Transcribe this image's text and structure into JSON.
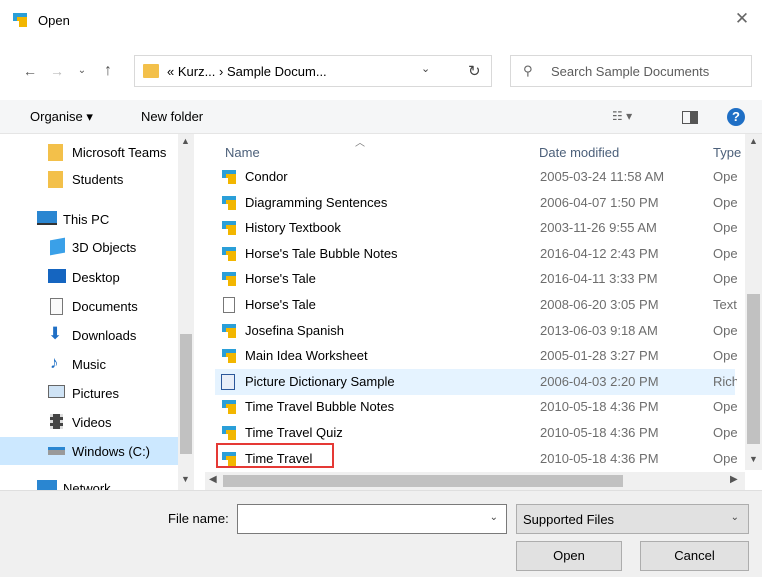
{
  "window": {
    "title": "Open"
  },
  "address": {
    "path": "« Kurz... › Sample Docum..."
  },
  "search": {
    "placeholder": "Search Sample Documents"
  },
  "toolbar": {
    "organise_label": "Organise ▾",
    "new_folder_label": "New folder",
    "help_label": "?"
  },
  "sidebar": {
    "items": [
      {
        "label": "Microsoft Teams",
        "icon": "folder-icon"
      },
      {
        "label": "Students",
        "icon": "folder-icon"
      },
      {
        "label": "This PC",
        "icon": "computer-icon"
      },
      {
        "label": "3D Objects",
        "icon": "3d-objects-icon"
      },
      {
        "label": "Desktop",
        "icon": "desktop-icon"
      },
      {
        "label": "Documents",
        "icon": "documents-icon"
      },
      {
        "label": "Downloads",
        "icon": "downloads-icon"
      },
      {
        "label": "Music",
        "icon": "music-icon"
      },
      {
        "label": "Pictures",
        "icon": "pictures-icon"
      },
      {
        "label": "Videos",
        "icon": "videos-icon"
      },
      {
        "label": "Windows (C:)",
        "icon": "drive-icon"
      },
      {
        "label": "Network",
        "icon": "network-icon"
      }
    ]
  },
  "columns": {
    "name": "Name",
    "date": "Date modified",
    "type": "Type"
  },
  "files": [
    {
      "name": "Condor",
      "date": "2005-03-24 11:58 AM",
      "type": "Oper"
    },
    {
      "name": "Diagramming Sentences",
      "date": "2006-04-07 1:50 PM",
      "type": "Oper"
    },
    {
      "name": "History Textbook",
      "date": "2003-11-26 9:55 AM",
      "type": "Oper"
    },
    {
      "name": "Horse's Tale Bubble Notes",
      "date": "2016-04-12 2:43 PM",
      "type": "Oper"
    },
    {
      "name": "Horse's Tale",
      "date": "2016-04-11 3:33 PM",
      "type": "Oper"
    },
    {
      "name": "Horse's Tale",
      "date": "2008-06-20 3:05 PM",
      "type": "Text"
    },
    {
      "name": "Josefina Spanish",
      "date": "2013-06-03 9:18 AM",
      "type": "Oper"
    },
    {
      "name": "Main Idea Worksheet",
      "date": "2005-01-28 3:27 PM",
      "type": "Oper"
    },
    {
      "name": "Picture Dictionary Sample",
      "date": "2006-04-03 2:20 PM",
      "type": "Rich"
    },
    {
      "name": "Time Travel Bubble Notes",
      "date": "2010-05-18 4:36 PM",
      "type": "Oper"
    },
    {
      "name": "Time Travel Quiz",
      "date": "2010-05-18 4:36 PM",
      "type": "Oper"
    },
    {
      "name": "Time Travel",
      "date": "2010-05-18 4:36 PM",
      "type": "Oper"
    }
  ],
  "bottom": {
    "file_name_label": "File name:",
    "file_name_value": "",
    "filter_value": "Supported Files",
    "open_label": "Open",
    "cancel_label": "Cancel"
  },
  "colors": {
    "accent": "#1f6fc5",
    "selection": "#cce8ff",
    "hover": "#e5f3ff",
    "highlight": "#e53935",
    "folder": "#f3c04a"
  }
}
